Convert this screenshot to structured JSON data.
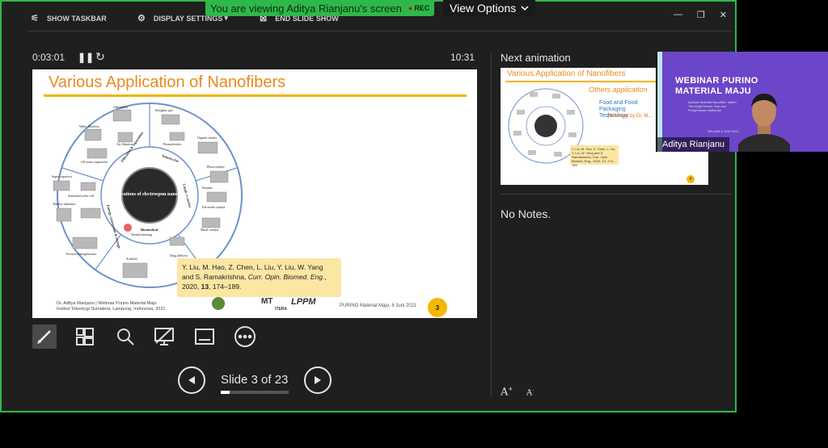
{
  "share_banner": {
    "text": "You are viewing Aditya Rianjanu's screen",
    "rec": "REC",
    "view_options": "View Options"
  },
  "topbar": {
    "show_taskbar": "SHOW TASKBAR",
    "display_settings": "DISPLAY SETTINGS",
    "end_slide_show": "END SLIDE SHOW"
  },
  "presenter": {
    "elapsed": "0:03:01",
    "clock": "10:31"
  },
  "slide": {
    "title": "Various Application of Nanofibers",
    "center_label": "Applications of electrospun nanofibers",
    "categories": [
      "Filtration & separation",
      "Sensors for",
      "Catalyst carrier",
      "Energy conversion & storage",
      "Biomedical"
    ],
    "apps": [
      "Adsorption",
      "Inorganic gas",
      "Water filtration",
      "Air filtration",
      "Biomolecules",
      "Organic matter",
      "Oil-water separation",
      "Photocatalyst",
      "Super capacitor",
      "Enzyme",
      "Sensitized solar cell",
      "Electrode catalyst",
      "Battery separator",
      "Metal catalyst",
      "Friction Nanogenerator",
      "Wound dressing",
      "Scaffold",
      "Drug delivery"
    ],
    "ref_line1": "Y. Liu, M. Hao, Z. Chen, L. Liu, Y. Liu, W. Yang",
    "ref_line2_prefix": "and S. Ramakrishna, ",
    "ref_journal": "Curr. Opin. Biomed. Eng.",
    "ref_line3_prefix": "2020, ",
    "ref_volume": "13",
    "ref_line3_suffix": ", 174–189.",
    "footer_left_1": "Dr. Aditya Rianjanu | Webinar Purino Material Maju",
    "footer_left_2": "Institut Teknologi Sumatera, Lampung, Indonesia, 2021",
    "footer_right": "PURINO Material Maju, 8 Juni 2021",
    "logo_lppm": "LPPM",
    "logo_mt": "MT",
    "logo_iteba": "ITERA",
    "number": "3"
  },
  "navigation": {
    "counter": "Slide 3 of 23",
    "current": 3,
    "total": 23
  },
  "next_pane": {
    "label": "Next animation",
    "title": "Various Application of Nanofibers",
    "others": "Others application",
    "food": "Food and Food Packaging Technology",
    "delivered": "(delivered by Dr. M...",
    "ref": "Y. Liu, M. Hao, Z. Chen, L. Liu, Y. Liu, W. Yang and S. Ramakrishna, Curr. Opin. Biomed. Eng., 2020, 13, 174–189.",
    "number": "4"
  },
  "notes": {
    "text": "No Notes."
  },
  "webcam": {
    "title_line1": "WEBINAR PURINO",
    "title_line2": "MATERIAL MAJU",
    "subtitle": "Aplikasi Material Nanofiber dalam Teknologi Sensor Gas dan Pengemasan Makanan",
    "date": "SELASA 8 JUNI 2021",
    "name": "Aditya Rianjanu"
  },
  "colors": {
    "accent_green": "#2fb84a",
    "slide_title": "#ea8a1f",
    "webcam_bg": "#6c46c9"
  }
}
